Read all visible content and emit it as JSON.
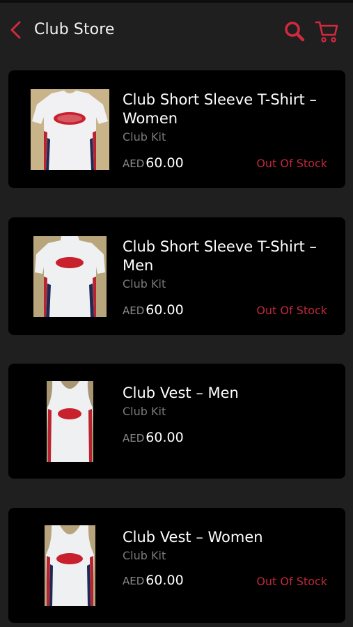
{
  "header": {
    "title": "Club Store",
    "back_icon": "chevron-left-icon",
    "search_icon": "search-icon",
    "cart_icon": "cart-icon"
  },
  "colors": {
    "accent": "#d2293f",
    "background": "#1f1f1f",
    "card": "#000000",
    "out_of_stock": "#c1283b"
  },
  "products": [
    {
      "name_line1": "Club Short Sleeve T-Shirt –",
      "name_line2": "Women",
      "category": "Club Kit",
      "currency": "AED",
      "price": "60.00",
      "stock": "Out Of Stock"
    },
    {
      "name_line1": "Club Short Sleeve T-Shirt –",
      "name_line2": "Men",
      "category": "Club Kit",
      "currency": "AED",
      "price": "60.00",
      "stock": "Out Of Stock"
    },
    {
      "name_line1": "Club Vest – Men",
      "category": "Club Kit",
      "currency": "AED",
      "price": "60.00"
    },
    {
      "name_line1": "Club Vest – Women",
      "category": "Club Kit",
      "currency": "AED",
      "price": "60.00",
      "stock": "Out Of Stock"
    }
  ]
}
